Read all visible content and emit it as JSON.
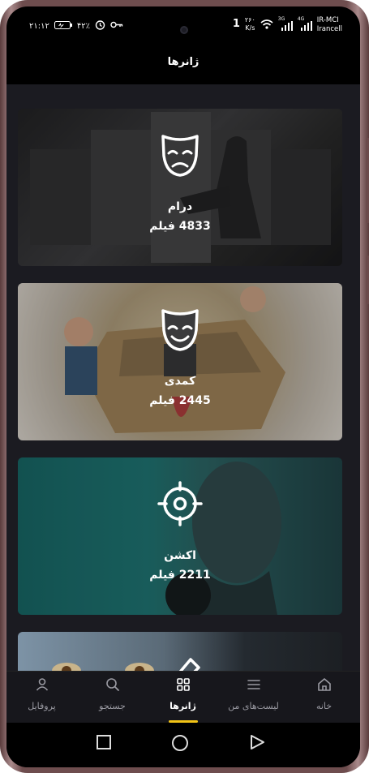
{
  "status_bar": {
    "time": "۲۱:۱۲",
    "battery": "۴۲٪",
    "speed_value": "۲۶۰",
    "speed_unit": "K/s",
    "signal_1": "3G",
    "signal_2": "4G",
    "carrier_1": "IR-MCI",
    "carrier_2": "Irancell",
    "icons": [
      "alarm-icon",
      "key-icon",
      "wifi-icon",
      "signal-icon",
      "battery-icon"
    ]
  },
  "header": {
    "title": "ژانرها"
  },
  "genres": [
    {
      "name": "درام",
      "count": "4833 فیلم",
      "icon": "sad-mask-icon"
    },
    {
      "name": "کمدی",
      "count": "2445 فیلم",
      "icon": "happy-mask-icon"
    },
    {
      "name": "اکشن",
      "count": "2211 فیلم",
      "icon": "crosshair-icon"
    },
    {
      "name": "",
      "count": "",
      "icon": "knife-icon"
    }
  ],
  "bottom_nav": {
    "items": [
      {
        "label": "پروفایل",
        "icon": "user-icon"
      },
      {
        "label": "جستجو",
        "icon": "search-icon"
      },
      {
        "label": "ژانرها",
        "icon": "grid-icon",
        "active": true
      },
      {
        "label": "لیست‌های من",
        "icon": "list-icon"
      },
      {
        "label": "خانه",
        "icon": "home-icon"
      }
    ],
    "active_color": "#f2c417"
  }
}
